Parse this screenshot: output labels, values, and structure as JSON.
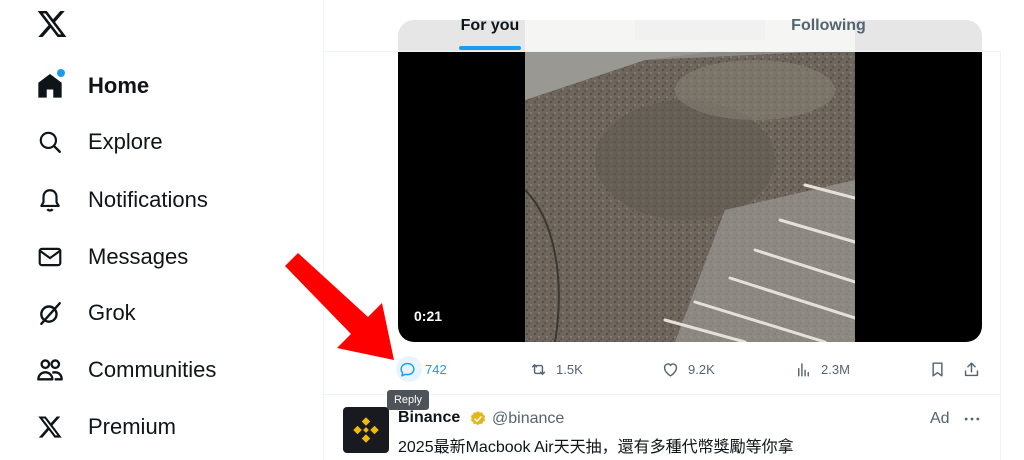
{
  "sidebar": {
    "items": [
      {
        "label": "Home",
        "icon": "home-icon"
      },
      {
        "label": "Explore",
        "icon": "search-icon"
      },
      {
        "label": "Notifications",
        "icon": "bell-icon"
      },
      {
        "label": "Messages",
        "icon": "envelope-icon"
      },
      {
        "label": "Grok",
        "icon": "grok-icon"
      },
      {
        "label": "Communities",
        "icon": "people-icon"
      },
      {
        "label": "Premium",
        "icon": "x-logo-icon"
      }
    ]
  },
  "tabs": [
    {
      "label": "For you",
      "active": true
    },
    {
      "label": "Following",
      "active": false
    }
  ],
  "video": {
    "time": "0:21"
  },
  "actions": {
    "reply": "742",
    "repost": "1.5K",
    "like": "9.2K",
    "views": "2.3M"
  },
  "tooltip": "Reply",
  "ad": {
    "name": "Binance",
    "handle": "@binance",
    "text": "2025最新Macbook Air天天抽，還有多種代幣獎勵等你拿",
    "label": "Ad"
  },
  "colors": {
    "accent": "#1d9bf0",
    "text": "#0f1419",
    "muted": "#536471",
    "arrow": "#ff0000",
    "binance": "#f0b90b"
  }
}
